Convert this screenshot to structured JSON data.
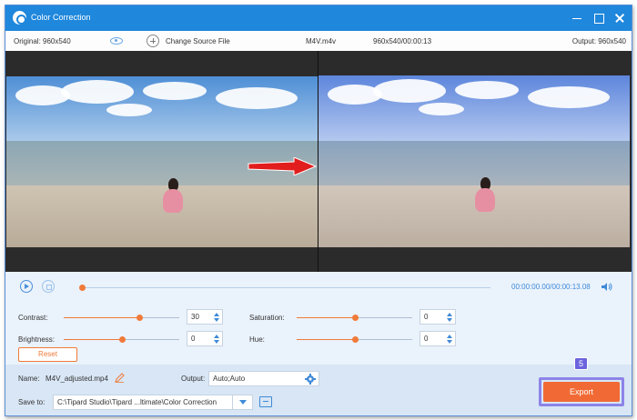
{
  "window": {
    "title": "Color Correction"
  },
  "info_bar": {
    "original": "Original: 960x540",
    "change_source": "Change Source File",
    "filename": "M4V.m4v",
    "resolution_duration": "960x540/00:00:13",
    "output": "Output: 960x540"
  },
  "playback": {
    "current_time": "00:00:00.00",
    "total_time": "/00:00:13.08",
    "progress_fraction": 0.0
  },
  "adjustments": {
    "contrast": {
      "label": "Contrast:",
      "value": "30",
      "slider_fraction": 0.65
    },
    "brightness": {
      "label": "Brightness:",
      "value": "0",
      "slider_fraction": 0.5
    },
    "saturation": {
      "label": "Saturation:",
      "value": "0",
      "slider_fraction": 0.5
    },
    "hue": {
      "label": "Hue:",
      "value": "0",
      "slider_fraction": 0.5
    },
    "reset_label": "Reset"
  },
  "footer": {
    "name_label": "Name:",
    "name_value": "M4V_adjusted.mp4",
    "output_label": "Output:",
    "output_value": "Auto;Auto",
    "saveto_label": "Save to:",
    "saveto_value": "C:\\Tipard Studio\\Tipard ...ltimate\\Color Correction",
    "export_label": "Export",
    "step_badge": "5"
  },
  "colors": {
    "titlebar": "#1f87dc",
    "accent_orange": "#f07a39",
    "highlight_purple": "#8c84e8",
    "link_blue": "#3f8ad8"
  }
}
